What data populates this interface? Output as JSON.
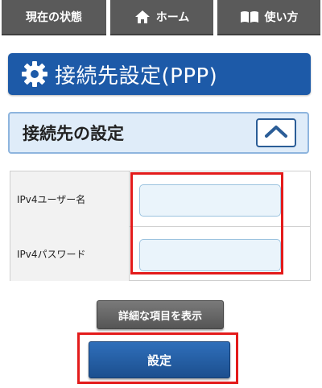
{
  "nav": {
    "status_label": "現在の状態",
    "home_label": "ホーム",
    "help_label": "使い方",
    "home_icon": "home-icon",
    "help_icon": "book-icon"
  },
  "page": {
    "title": "接続先設定(PPP)",
    "title_icon": "gear-icon"
  },
  "section": {
    "title": "接続先の設定",
    "toggle_icon": "chevron-up-icon"
  },
  "form": {
    "rows": [
      {
        "label": "IPv4ユーザー名",
        "value": ""
      },
      {
        "label": "IPv4パスワード",
        "value": ""
      }
    ]
  },
  "buttons": {
    "advanced_label": "詳細な項目を表示",
    "save_label": "設定"
  },
  "colors": {
    "nav_bg": "#5a5a5a",
    "title_bg": "#1d5aa8",
    "section_bg": "#dfecf9",
    "highlight": "#e31b1b",
    "save_bg": "#1c4f8f"
  }
}
